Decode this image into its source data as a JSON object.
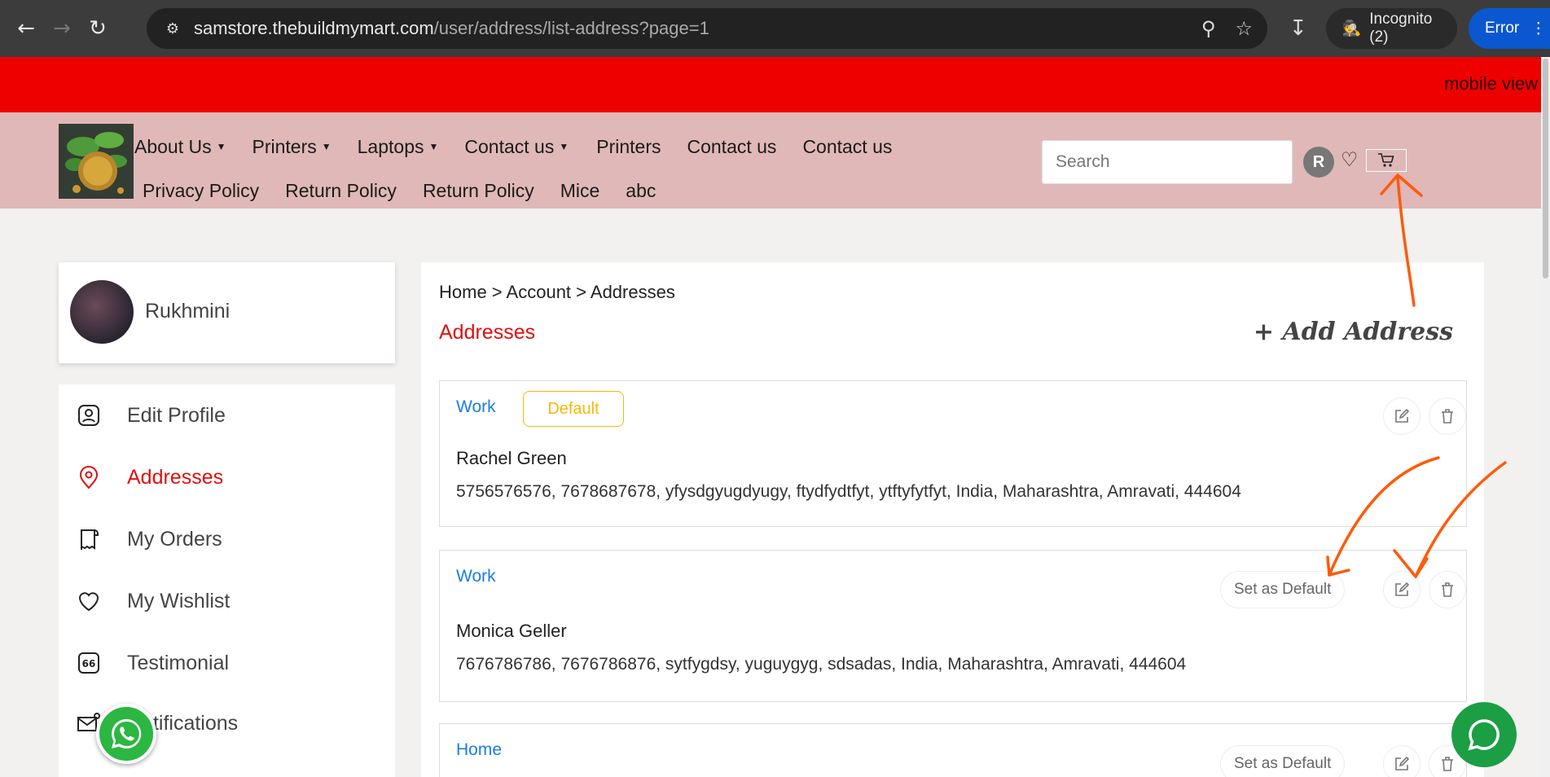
{
  "browser": {
    "url_host": "samstore.thebuildmymart.com",
    "url_path": "/user/address/list-address?page=1",
    "incognito_label": "Incognito (2)",
    "error_label": "Error"
  },
  "banner": {
    "text": "mobile view"
  },
  "header": {
    "menu_row1": [
      "About Us",
      "Printers",
      "Laptops",
      "Contact us",
      "Printers",
      "Contact us",
      "Contact us"
    ],
    "menu_row2": [
      "Privacy Policy",
      "Return Policy",
      "Return Policy",
      "Mice",
      "abc"
    ],
    "search_placeholder": "Search",
    "avatar_letter": "R"
  },
  "profile": {
    "name": "Rukhmini"
  },
  "sidebar": {
    "items": [
      {
        "label": "Edit Profile",
        "icon": "user-icon"
      },
      {
        "label": "Addresses",
        "icon": "location-pin-icon"
      },
      {
        "label": "My Orders",
        "icon": "receipt-icon"
      },
      {
        "label": "My Wishlist",
        "icon": "heart-icon"
      },
      {
        "label": "Testimonial",
        "icon": "quote-icon"
      },
      {
        "label": "Notifications",
        "icon": "mail-icon"
      }
    ]
  },
  "main": {
    "breadcrumb": "Home > Account > Addresses",
    "title": "Addresses",
    "add_label": "+ Add Address",
    "set_default_label": "Set as Default",
    "addresses": [
      {
        "type": "Work",
        "badge": "Default",
        "name": "Rachel Green",
        "details": "5756576576, 7678687678, yfysdgyugdyugy, ftydfydtfyt, ytftyfytfyt, India, Maharashtra, Amravati, 444604"
      },
      {
        "type": "Work",
        "name": "Monica Geller",
        "details": "7676786786, 7676786876, sytfygdsy, yuguygyg, sdsadas, India, Maharashtra, Amravati, 444604"
      },
      {
        "type": "Home"
      }
    ]
  },
  "colors": {
    "banner": "#ee0000",
    "header": "#e0b8b8",
    "accent": "#e01010",
    "link": "#1a7de0",
    "badge": "#f3b90b",
    "annotation": "#ff5a0a"
  }
}
